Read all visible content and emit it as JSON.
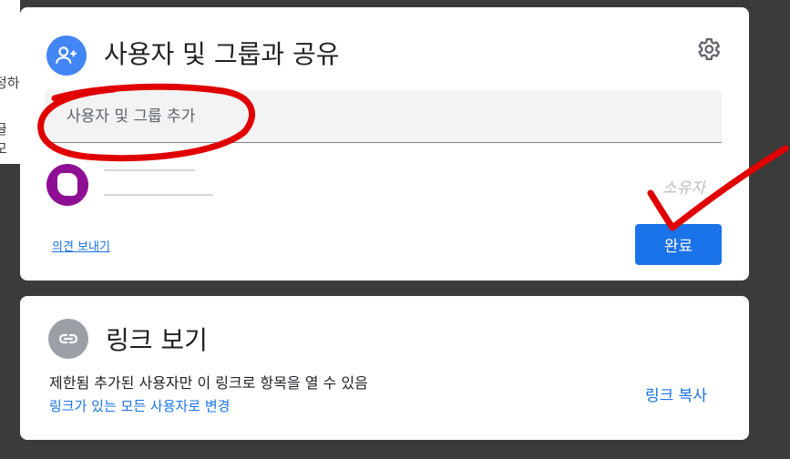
{
  "background": {
    "fragments": [
      "정하",
      "글 모"
    ]
  },
  "share_dialog": {
    "title": "사용자 및 그룹과 공유",
    "add_input": {
      "placeholder": "사용자 및 그룹 추가",
      "value": ""
    },
    "owner_role": "소유자",
    "feedback_link": "의견 보내기",
    "done_button": "완료"
  },
  "link_dialog": {
    "title": "링크 보기",
    "description": "제한됨 추가된 사용자만 이 링크로 항목을 열 수 있음",
    "change_link": "링크가 있는 모든 사용자로 변경",
    "copy_link": "링크 복사"
  },
  "colors": {
    "accent": "#1a73e8",
    "share_icon_bg": "#4285f4",
    "link_icon_bg": "#9aa0a6",
    "avatar_bg": "#8e0f93",
    "annotation": "#e00000"
  },
  "icons": {
    "share": "person-add-icon",
    "settings": "gear-icon",
    "link": "link-icon"
  }
}
